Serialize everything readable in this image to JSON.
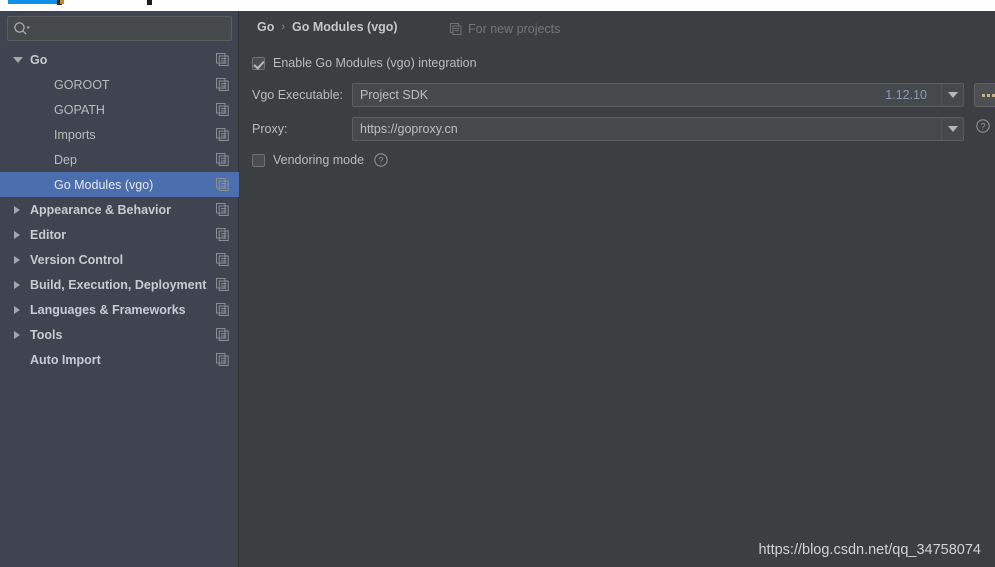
{
  "window": {
    "background_color": "#3c3f41",
    "sidebar_color": "#3f4450",
    "selection_color": "#4b6eaf"
  },
  "sidebar": {
    "search": {
      "placeholder": "",
      "value": "",
      "icon": "search-icon"
    },
    "items": [
      {
        "label": "Go",
        "level": 0,
        "twisty": "down",
        "bold": true,
        "selected": false,
        "copy_icon": "copy-icon"
      },
      {
        "label": "GOROOT",
        "level": 1,
        "twisty": "none",
        "bold": false,
        "selected": false,
        "copy_icon": "copy-icon"
      },
      {
        "label": "GOPATH",
        "level": 1,
        "twisty": "none",
        "bold": false,
        "selected": false,
        "copy_icon": "copy-icon"
      },
      {
        "label": "Imports",
        "level": 1,
        "twisty": "none",
        "bold": false,
        "selected": false,
        "copy_icon": "copy-icon"
      },
      {
        "label": "Dep",
        "level": 1,
        "twisty": "none",
        "bold": false,
        "selected": false,
        "copy_icon": "copy-icon"
      },
      {
        "label": "Go Modules (vgo)",
        "level": 1,
        "twisty": "none",
        "bold": false,
        "selected": true,
        "copy_icon": "copy-icon"
      },
      {
        "label": "Appearance & Behavior",
        "level": 0,
        "twisty": "right",
        "bold": true,
        "selected": false,
        "copy_icon": "copy-icon"
      },
      {
        "label": "Editor",
        "level": 0,
        "twisty": "right",
        "bold": true,
        "selected": false,
        "copy_icon": "copy-icon"
      },
      {
        "label": "Version Control",
        "level": 0,
        "twisty": "right",
        "bold": true,
        "selected": false,
        "copy_icon": "copy-icon"
      },
      {
        "label": "Build, Execution, Deployment",
        "level": 0,
        "twisty": "right",
        "bold": true,
        "selected": false,
        "copy_icon": "copy-icon"
      },
      {
        "label": "Languages & Frameworks",
        "level": 0,
        "twisty": "right",
        "bold": true,
        "selected": false,
        "copy_icon": "copy-icon"
      },
      {
        "label": "Tools",
        "level": 0,
        "twisty": "right",
        "bold": true,
        "selected": false,
        "copy_icon": "copy-icon"
      },
      {
        "label": "Auto Import",
        "level": 0,
        "twisty": "none",
        "bold": true,
        "selected": false,
        "copy_icon": "copy-icon"
      }
    ]
  },
  "main": {
    "breadcrumb": {
      "root": "Go",
      "separator": "›",
      "current": "Go Modules (vgo)"
    },
    "for_new_projects": {
      "label": "For new projects",
      "icon": "copy-icon"
    },
    "enable_checkbox": {
      "label": "Enable Go Modules (vgo) integration",
      "checked": true
    },
    "vgo_executable": {
      "label": "Vgo Executable:",
      "value": "Project SDK",
      "version": "1.12.10",
      "dropdown_icon": "chevron-down-icon",
      "browse_label": "...",
      "browse_icon": "ellipsis-icon"
    },
    "proxy": {
      "label": "Proxy:",
      "value": "https://goproxy.cn",
      "dropdown_icon": "chevron-down-icon",
      "help_icon": "help-circle-icon"
    },
    "vendoring": {
      "label": "Vendoring mode",
      "checked": false,
      "help_icon": "help-circle-icon"
    }
  },
  "watermark": {
    "text": "https://blog.csdn.net/qq_34758074"
  }
}
